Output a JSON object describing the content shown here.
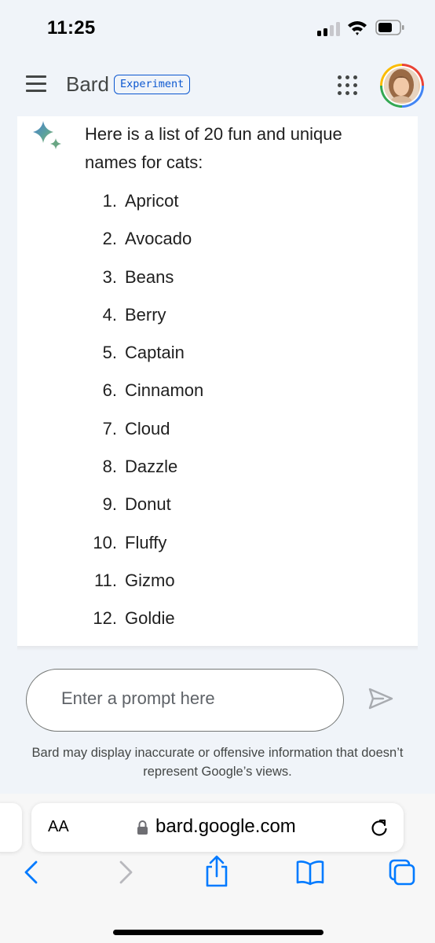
{
  "status_bar": {
    "time": "11:25"
  },
  "header": {
    "title": "Bard",
    "badge": "Experiment"
  },
  "response": {
    "intro": "Here is a list of 20 fun and unique names for cats:",
    "items": [
      {
        "num": "1.",
        "name": "Apricot"
      },
      {
        "num": "2.",
        "name": "Avocado"
      },
      {
        "num": "3.",
        "name": "Beans"
      },
      {
        "num": "4.",
        "name": "Berry"
      },
      {
        "num": "5.",
        "name": "Captain"
      },
      {
        "num": "6.",
        "name": "Cinnamon"
      },
      {
        "num": "7.",
        "name": "Cloud"
      },
      {
        "num": "8.",
        "name": "Dazzle"
      },
      {
        "num": "9.",
        "name": "Donut"
      },
      {
        "num": "10.",
        "name": "Fluffy"
      },
      {
        "num": "11.",
        "name": "Gizmo"
      },
      {
        "num": "12.",
        "name": "Goldie"
      }
    ]
  },
  "prompt": {
    "placeholder": "Enter a prompt here"
  },
  "disclaimer": "Bard may display inaccurate or offensive information that doesn’t represent Google’s views.",
  "browser": {
    "text_size_label": "AA",
    "url": "bard.google.com"
  },
  "icons": {
    "menu": "hamburger-menu-icon",
    "apps": "google-apps-grid-icon",
    "sparkle": "bard-sparkle-icon",
    "send": "send-icon",
    "lock": "lock-icon",
    "reload": "reload-icon",
    "back": "back-arrow-icon",
    "forward": "forward-arrow-icon",
    "share": "share-icon",
    "bookmarks": "bookmarks-icon",
    "tabs": "tabs-icon"
  },
  "colors": {
    "accent": "#0b57d0",
    "page_bg": "#f0f4f9",
    "ios_blue": "#007aff"
  }
}
